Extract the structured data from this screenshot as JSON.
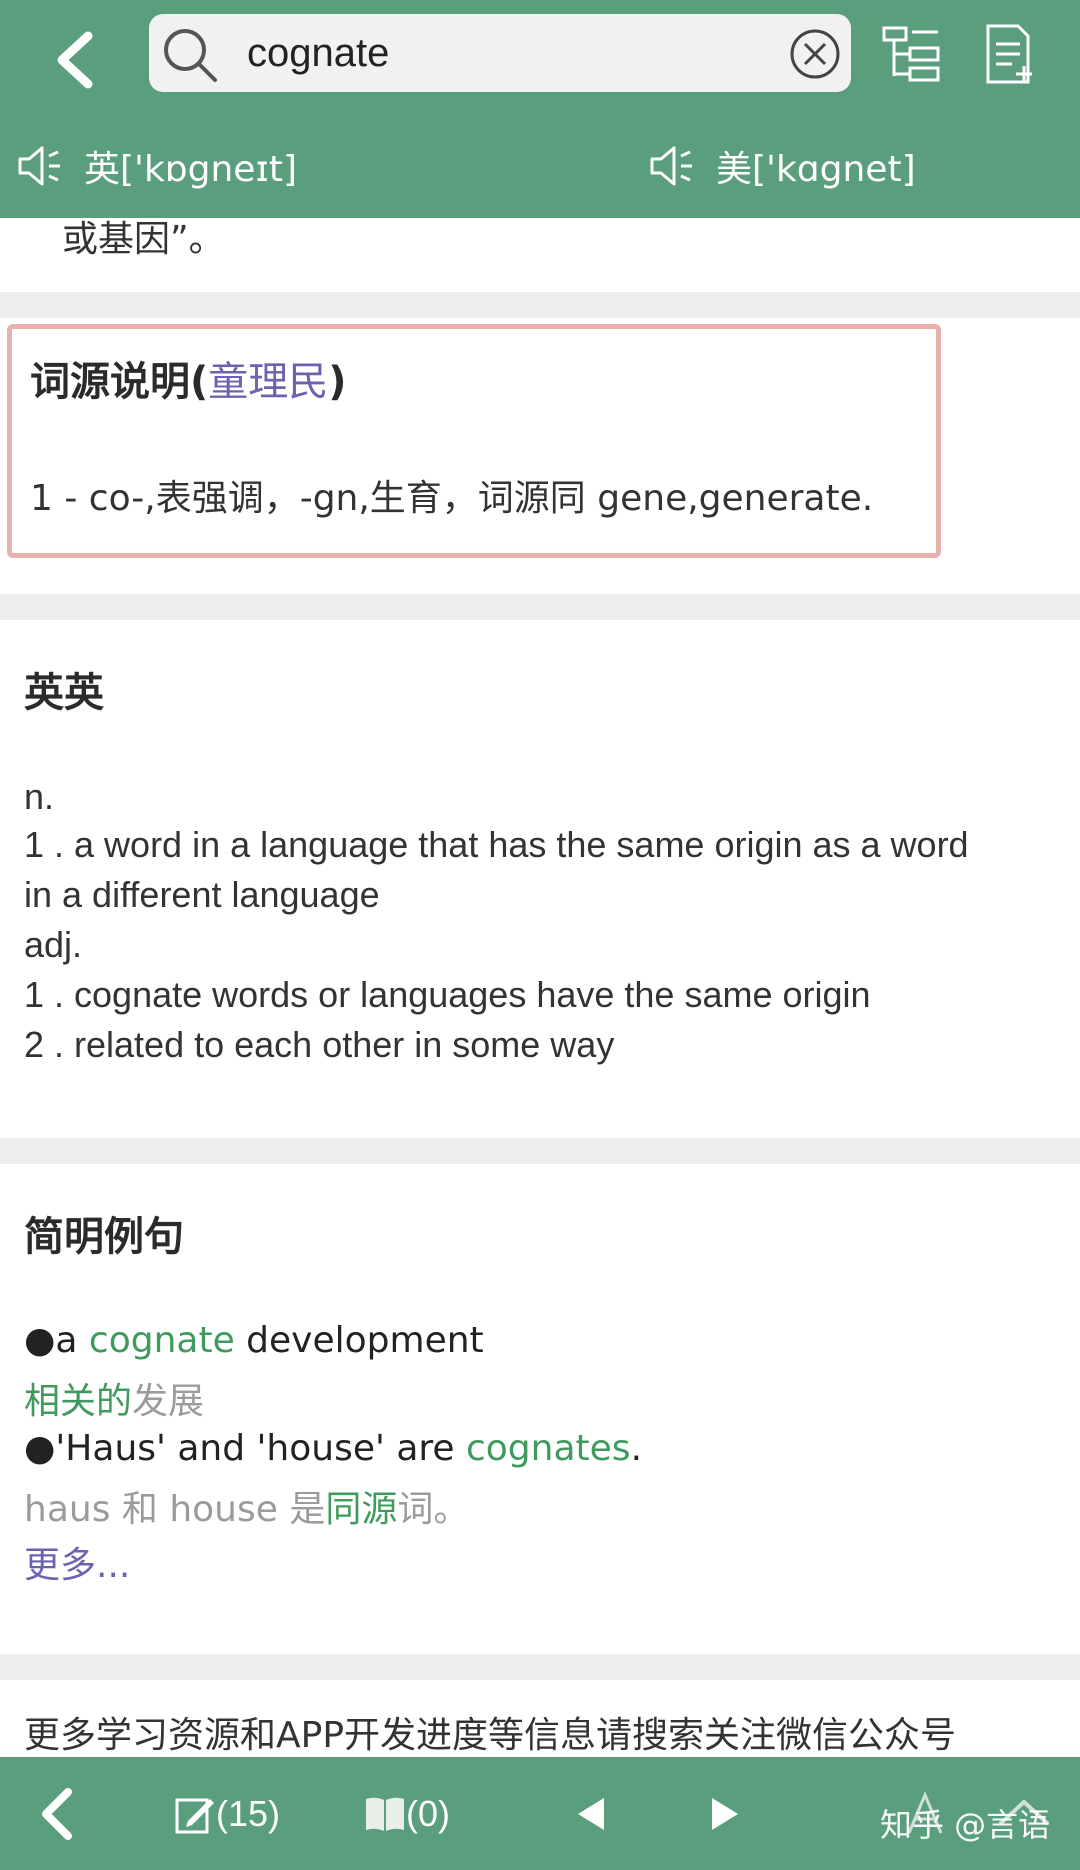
{
  "search": {
    "query": "cognate"
  },
  "pronunciation": {
    "uk": {
      "label": "英['kɒgneɪt]"
    },
    "us": {
      "label": "美['kɑgnet]"
    }
  },
  "previous_tail": "或基因”。",
  "etymology": {
    "heading": "词源说明(",
    "author": "童理民",
    "heading_close": ")",
    "line": "1 - co-,表强调，-gn,生育，词源同 gene,generate."
  },
  "en_en": {
    "heading": "英英",
    "lines": [
      "n.",
      "1 . a word in a language that has the same origin as a word",
      "in a different language",
      "adj.",
      "1 . cognate words or languages have the same origin",
      "2 . related to each other in some way"
    ]
  },
  "examples": {
    "heading": "简明例句",
    "items": [
      {
        "en_pre": "●a ",
        "en_hl": "cognate",
        "en_post": " development",
        "zh_hl": "相关的",
        "zh_rest": "发展"
      },
      {
        "en_pre": "●'Haus' and 'house' are ",
        "en_hl": "cognates",
        "en_post": ".",
        "zh_pre": "haus 和 house 是",
        "zh_hl": "同源",
        "zh_rest": "词。"
      }
    ],
    "more": "更多..."
  },
  "footer_note": "更多学习资源和APP开发进度等信息请搜索关注微信公众号",
  "bottom_bar": {
    "notes_count": "(15)",
    "book_count": "(0)"
  },
  "watermark": "知乎 @言语",
  "colors": {
    "header_green": "#5a9e7d",
    "highlight_green": "#3f9a5e",
    "link_purple": "#6b63b0",
    "etym_border": "#e8b1ae"
  }
}
